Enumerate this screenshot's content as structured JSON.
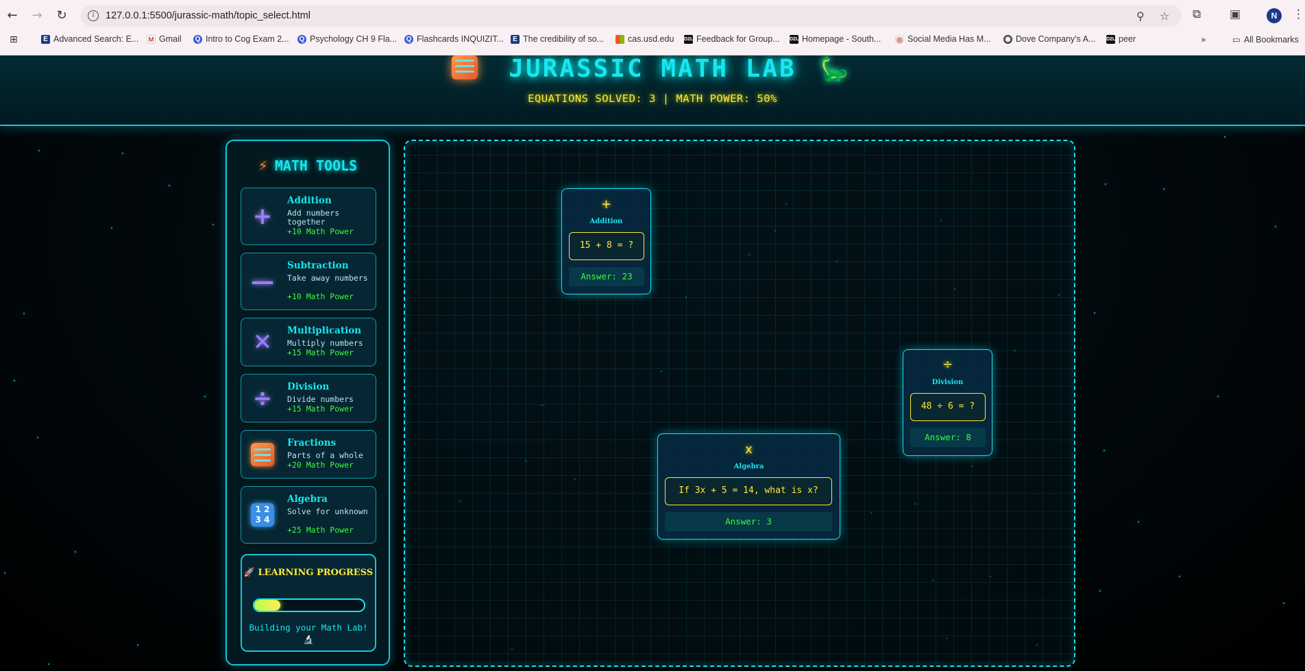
{
  "browser": {
    "url": "127.0.0.1:5500/jurassic-math/topic_select.html",
    "avatar_letter": "N",
    "bookmarks": [
      "Advanced Search: E...",
      "Gmail",
      "Intro to Cog Exam 2...",
      "Psychology CH 9 Fla...",
      "Flashcards INQUIZIT...",
      "The credibility of so...",
      "cas.usd.edu",
      "Feedback for Group...",
      "Homepage - South...",
      "Social Media Has M...",
      "Dove Company's A...",
      "peer"
    ],
    "all_bookmarks": "All Bookmarks"
  },
  "header": {
    "title": "JURASSIC MATH LAB",
    "stats": "EQUATIONS SOLVED: 3 | MATH POWER: 50%"
  },
  "sidebar": {
    "title": "MATH TOOLS",
    "tools": [
      {
        "name": "Addition",
        "desc": "Add numbers together",
        "power": "+10 Math Power",
        "icon": "+"
      },
      {
        "name": "Subtraction",
        "desc": "Take away numbers",
        "power": "+10 Math Power",
        "icon": "—"
      },
      {
        "name": "Multiplication",
        "desc": "Multiply numbers",
        "power": "+15 Math Power",
        "icon": "✕"
      },
      {
        "name": "Division",
        "desc": "Divide numbers",
        "power": "+15 Math Power",
        "icon": "÷"
      },
      {
        "name": "Fractions",
        "desc": "Parts of a whole",
        "power": "+20 Math Power",
        "icon": "abacus"
      },
      {
        "name": "Algebra",
        "desc": "Solve for unknown",
        "power": "+25 Math Power",
        "icon": "1234"
      }
    ],
    "progress": {
      "title": "🚀 LEARNING PROGRESS",
      "level": 0.24,
      "text": "Building your Math Lab! 🔬"
    }
  },
  "cards": [
    {
      "op": "+",
      "topic": "Addition",
      "question": "15 + 8 = ?",
      "answer": "Answer: 23"
    },
    {
      "op": "÷",
      "topic": "Division",
      "question": "48 ÷ 6 = ?",
      "answer": "Answer: 8"
    },
    {
      "op": "x",
      "topic": "Algebra",
      "question": "If 3x + 5 = 14, what is x?",
      "answer": "Answer: 3"
    }
  ],
  "colors": {
    "accent": "#18e6ee",
    "highlight": "#ffe93a",
    "power_green": "#3dfa3d",
    "tool_icon": "#9a7cff"
  }
}
